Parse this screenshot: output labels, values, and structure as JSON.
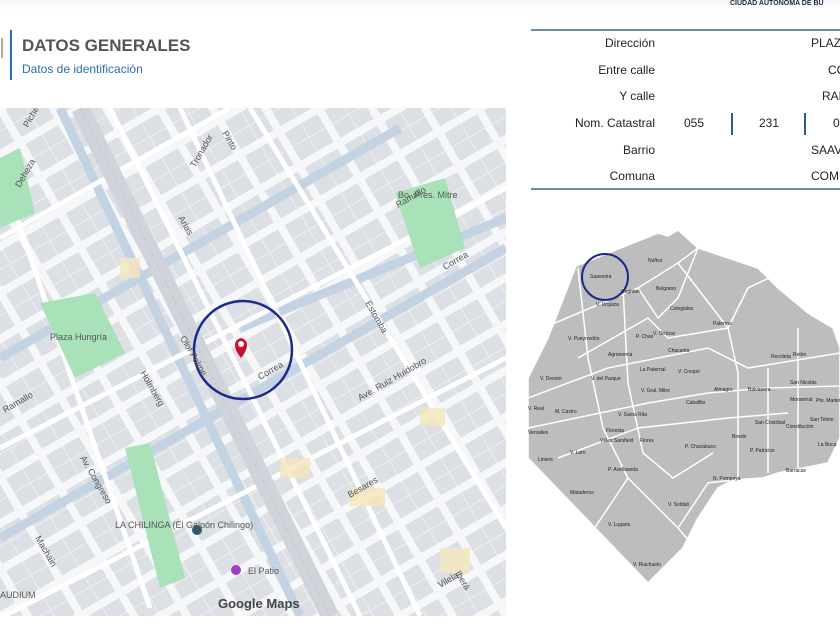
{
  "header": {
    "city": "CIUDAD AUTÓNOMA DE BU",
    "title": "DATOS GENERALES",
    "subtitle": "Datos de identificación"
  },
  "info": {
    "direccion": {
      "label": "Dirección",
      "value": "PLAZ"
    },
    "entre_calle": {
      "label": "Entre calle",
      "value": "CO"
    },
    "y_calle": {
      "label": "Y calle",
      "value": "RAM"
    },
    "nom_catastral": {
      "label": "Nom. Catastral",
      "values": [
        "055",
        "231",
        "0"
      ]
    },
    "barrio": {
      "label": "Barrio",
      "value": "SAAV"
    },
    "comuna": {
      "label": "Comuna",
      "value": "COMU"
    }
  },
  "street_map": {
    "streets": [
      "Plaza",
      "Deheza",
      "Tronador",
      "Arias",
      "Ramallo",
      "Pinto",
      "Correa",
      "Estomba",
      "Ave. Ruiz Huidobro",
      "Olof Palme",
      "Holmberg",
      "Av. Congreso",
      "Machain",
      "Besares",
      "Vilela",
      "Iberá",
      "Picheuta",
      "Plaza Hungría",
      "Bo. Pres. Mitre"
    ],
    "pois": [
      "LA CHILINGA (El Galpón Chilingo)",
      "El Patio",
      "AUDIUM",
      "Google Maps"
    ]
  },
  "barrios_map": {
    "labels": [
      "Saavedra",
      "Núñez",
      "Coghlan",
      "Belgrano",
      "V. Urquiza",
      "Colegiales",
      "Palermo",
      "V. Pueyrredón",
      "P. Chas",
      "V. Ortúzar",
      "Chacarita",
      "Agronomía",
      "La Paternal",
      "V. Crespo",
      "Recoleta",
      "Retiro",
      "V. Devoto",
      "V. del Parque",
      "V. Gral. Mitre",
      "Almagro",
      "Balvanera",
      "San Nicolás",
      "V. Real",
      "M. Castro",
      "V. Santa Rita",
      "Caballito",
      "Monserrat",
      "Pto. Madero",
      "San Cristóbal",
      "San Telmo",
      "Versalles",
      "Floresta",
      "Vélez Sarsfield",
      "Constitución",
      "V. Luro",
      "Flores",
      "P. Chacabuco",
      "Boedo",
      "P. Patricios",
      "La Boca",
      "Liniers",
      "P. Avellaneda",
      "N. Pompeya",
      "Barracas",
      "Mataderos",
      "V. Soldati",
      "V. Lugano",
      "V. Riachuelo"
    ]
  }
}
